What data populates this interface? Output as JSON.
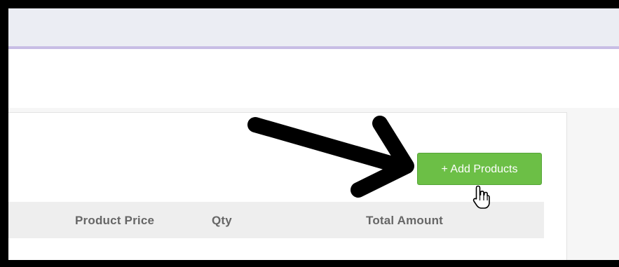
{
  "toolbar": {
    "add_products_label": "+ Add Products"
  },
  "table": {
    "columns": [
      "Product Price",
      "Qty",
      "Total Amount"
    ]
  },
  "colors": {
    "accent": "#6cbf46",
    "top_bar": "#ebedf3",
    "top_bar_border": "#c7bde5"
  },
  "annotation": {
    "icon": "arrow-icon"
  },
  "cursor": {
    "icon": "hand-pointer-icon"
  }
}
